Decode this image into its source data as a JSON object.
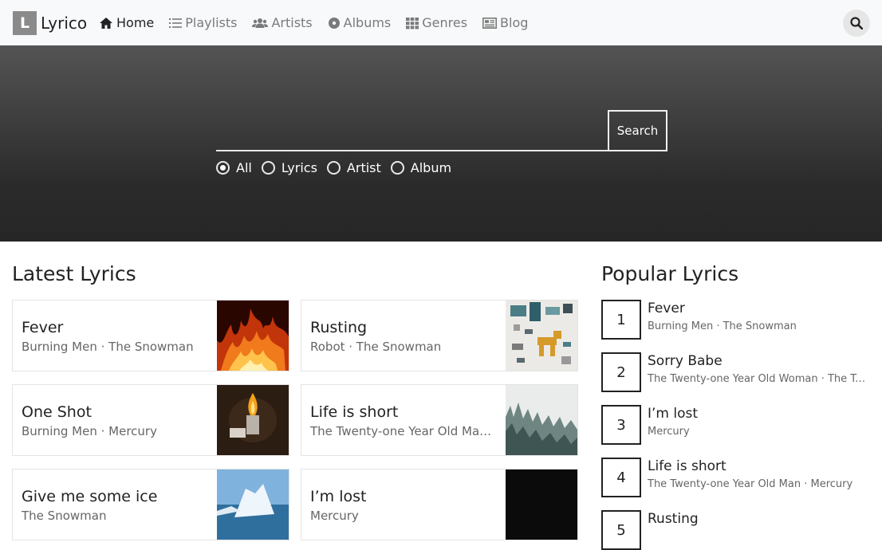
{
  "brand": {
    "logo_letter": "L",
    "name": "Lyrico"
  },
  "nav": {
    "items": [
      {
        "label": "Home",
        "icon": "home-icon",
        "active": true
      },
      {
        "label": "Playlists",
        "icon": "list-icon",
        "active": false
      },
      {
        "label": "Artists",
        "icon": "users-icon",
        "active": false
      },
      {
        "label": "Albums",
        "icon": "disc-icon",
        "active": false
      },
      {
        "label": "Genres",
        "icon": "grid-icon",
        "active": false
      },
      {
        "label": "Blog",
        "icon": "newspaper-icon",
        "active": false
      }
    ],
    "search_icon": "search-icon"
  },
  "hero": {
    "search_button": "Search",
    "search_value": "",
    "filters": [
      {
        "label": "All",
        "checked": true
      },
      {
        "label": "Lyrics",
        "checked": false
      },
      {
        "label": "Artist",
        "checked": false
      },
      {
        "label": "Album",
        "checked": false
      }
    ]
  },
  "latest": {
    "title": "Latest Lyrics",
    "items": [
      {
        "title": "Fever",
        "sub": "Burning Men · The Snowman",
        "image": "fire"
      },
      {
        "title": "Rusting",
        "sub": "Robot · The Snowman",
        "image": "pixel-art"
      },
      {
        "title": "One Shot",
        "sub": "Burning Men · Mercury",
        "image": "lighter"
      },
      {
        "title": "Life is short",
        "sub": "The Twenty-one Year Old Man · Mercury",
        "image": "forest"
      },
      {
        "title": "Give me some ice",
        "sub": "The Snowman",
        "image": "iceberg"
      },
      {
        "title": "I’m lost",
        "sub": "Mercury",
        "image": "dark"
      }
    ]
  },
  "popular": {
    "title": "Popular Lyrics",
    "items": [
      {
        "rank": "1",
        "title": "Fever",
        "sub": "Burning Men · The Snowman"
      },
      {
        "rank": "2",
        "title": "Sorry Babe",
        "sub": "The Twenty-one Year Old Woman · The Twenty-one Year Old Man"
      },
      {
        "rank": "3",
        "title": "I’m lost",
        "sub": "Mercury"
      },
      {
        "rank": "4",
        "title": "Life is short",
        "sub": "The Twenty-one Year Old Man · Mercury"
      },
      {
        "rank": "5",
        "title": "Rusting",
        "sub": ""
      }
    ]
  }
}
